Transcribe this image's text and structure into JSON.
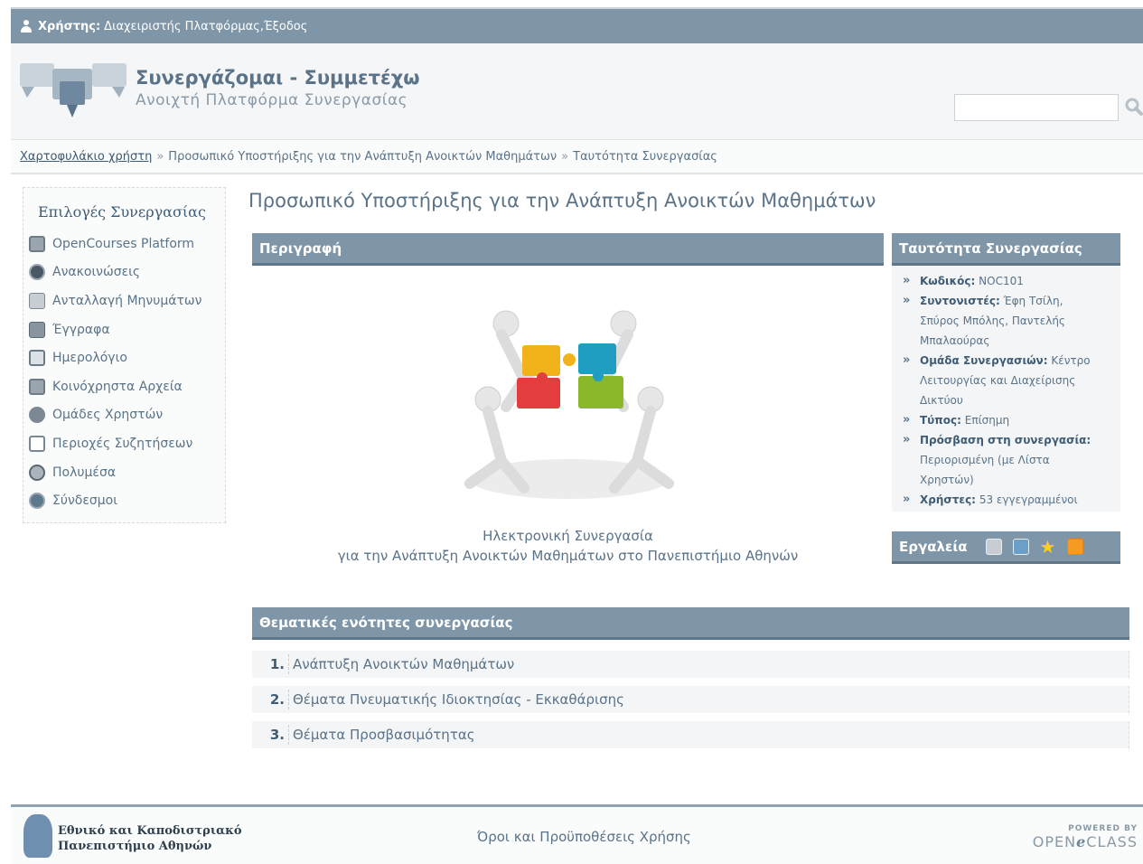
{
  "topbar": {
    "user_label": "Χρήστης:",
    "user_name": "Διαχειριστής Πλατφόρμας",
    "separator": ", ",
    "logout": "Έξοδος"
  },
  "header": {
    "title": "Συνεργάζομαι - Συμμετέχω",
    "subtitle": "Ανοιχτή Πλατφόρμα Συνεργασίας",
    "search_value": ""
  },
  "breadcrumb": {
    "home": "Χαρτοφυλάκιο χρήστη",
    "sep": "»",
    "level1": "Προσωπικό Υποστήριξης για την Ανάπτυξη Ανοικτών Μαθημάτων",
    "level2": "Ταυτότητα Συνεργασίας"
  },
  "sidebar": {
    "title": "Επιλογές Συνεργασίας",
    "items": [
      {
        "label": "OpenCourses Platform",
        "icon": "opencourses-icon"
      },
      {
        "label": "Ανακοινώσεις",
        "icon": "announcements-icon"
      },
      {
        "label": "Ανταλλαγή Μηνυμάτων",
        "icon": "messages-icon"
      },
      {
        "label": "Έγγραφα",
        "icon": "documents-icon"
      },
      {
        "label": "Ημερολόγιο",
        "icon": "calendar-icon"
      },
      {
        "label": "Κοινόχρηστα Αρχεία",
        "icon": "shared-files-icon"
      },
      {
        "label": "Ομάδες Χρηστών",
        "icon": "user-groups-icon"
      },
      {
        "label": "Περιοχές Συζητήσεων",
        "icon": "forum-icon"
      },
      {
        "label": "Πολυμέσα",
        "icon": "multimedia-icon"
      },
      {
        "label": "Σύνδεσμοι",
        "icon": "links-icon"
      }
    ]
  },
  "main": {
    "title": "Προσωπικό Υποστήριξης για την Ανάπτυξη Ανοικτών Μαθημάτων",
    "description": {
      "heading": "Περιγραφή",
      "line1": "Ηλεκτρονική Συνεργασία",
      "line2": "για την Ανάπτυξη Ανοικτών Μαθημάτων στο Πανεπιστήμιο Αθηνών"
    },
    "identity": {
      "heading": "Ταυτότητα Συνεργασίας",
      "code_label": "Κωδικός:",
      "code_value": "NOC101",
      "coordinators_label": "Συντονιστές:",
      "coordinators_line1": "Έφη Τσίλη,",
      "coordinators_line2": "Σπύρος Μπόλης, Παντελής",
      "coordinators_line3": "Μπαλαούρας",
      "group_label": "Ομάδα Συνεργασιών:",
      "group_line1": "Κέντρο",
      "group_line2": "Λειτουργίας και Διαχείρισης",
      "group_line3": "Δικτύου",
      "type_label": "Τύπος:",
      "type_value": "Επίσημη",
      "access_label": "Πρόσβαση στη συνεργασία:",
      "access_line1": "Περιορισμένη (με Λίστα",
      "access_line2": "Χρηστών)",
      "users_label": "Χρήστες:",
      "users_value": "53 εγγεγραμμένοι"
    },
    "tools": {
      "heading": "Εργαλεία",
      "icons": [
        "users-icon",
        "mail-icon",
        "star-icon",
        "rss-icon"
      ]
    },
    "themes": {
      "heading": "Θεματικές ενότητες συνεργασίας",
      "items": [
        {
          "num": "1.",
          "label": "Ανάπτυξη Ανοικτών Μαθημάτων"
        },
        {
          "num": "2.",
          "label": "Θέματα Πνευματικής Ιδιοκτησίας - Εκκαθάρισης"
        },
        {
          "num": "3.",
          "label": "Θέματα Προσβασιμότητας"
        }
      ]
    }
  },
  "footer": {
    "university_line1": "Εθνικό και Καποδιστριακό",
    "university_line2": "Πανεπιστήμιο Αθηνών",
    "terms": "Όροι και Προϋποθέσεις Χρήσης",
    "powered_by": "POWERED BY",
    "brand_part1": "OPEN",
    "brand_mid": "e",
    "brand_part2": "CLASS"
  },
  "colors": {
    "accent": "#7f96a8",
    "text": "#5a7389",
    "link_dark": "#3f5c74"
  }
}
